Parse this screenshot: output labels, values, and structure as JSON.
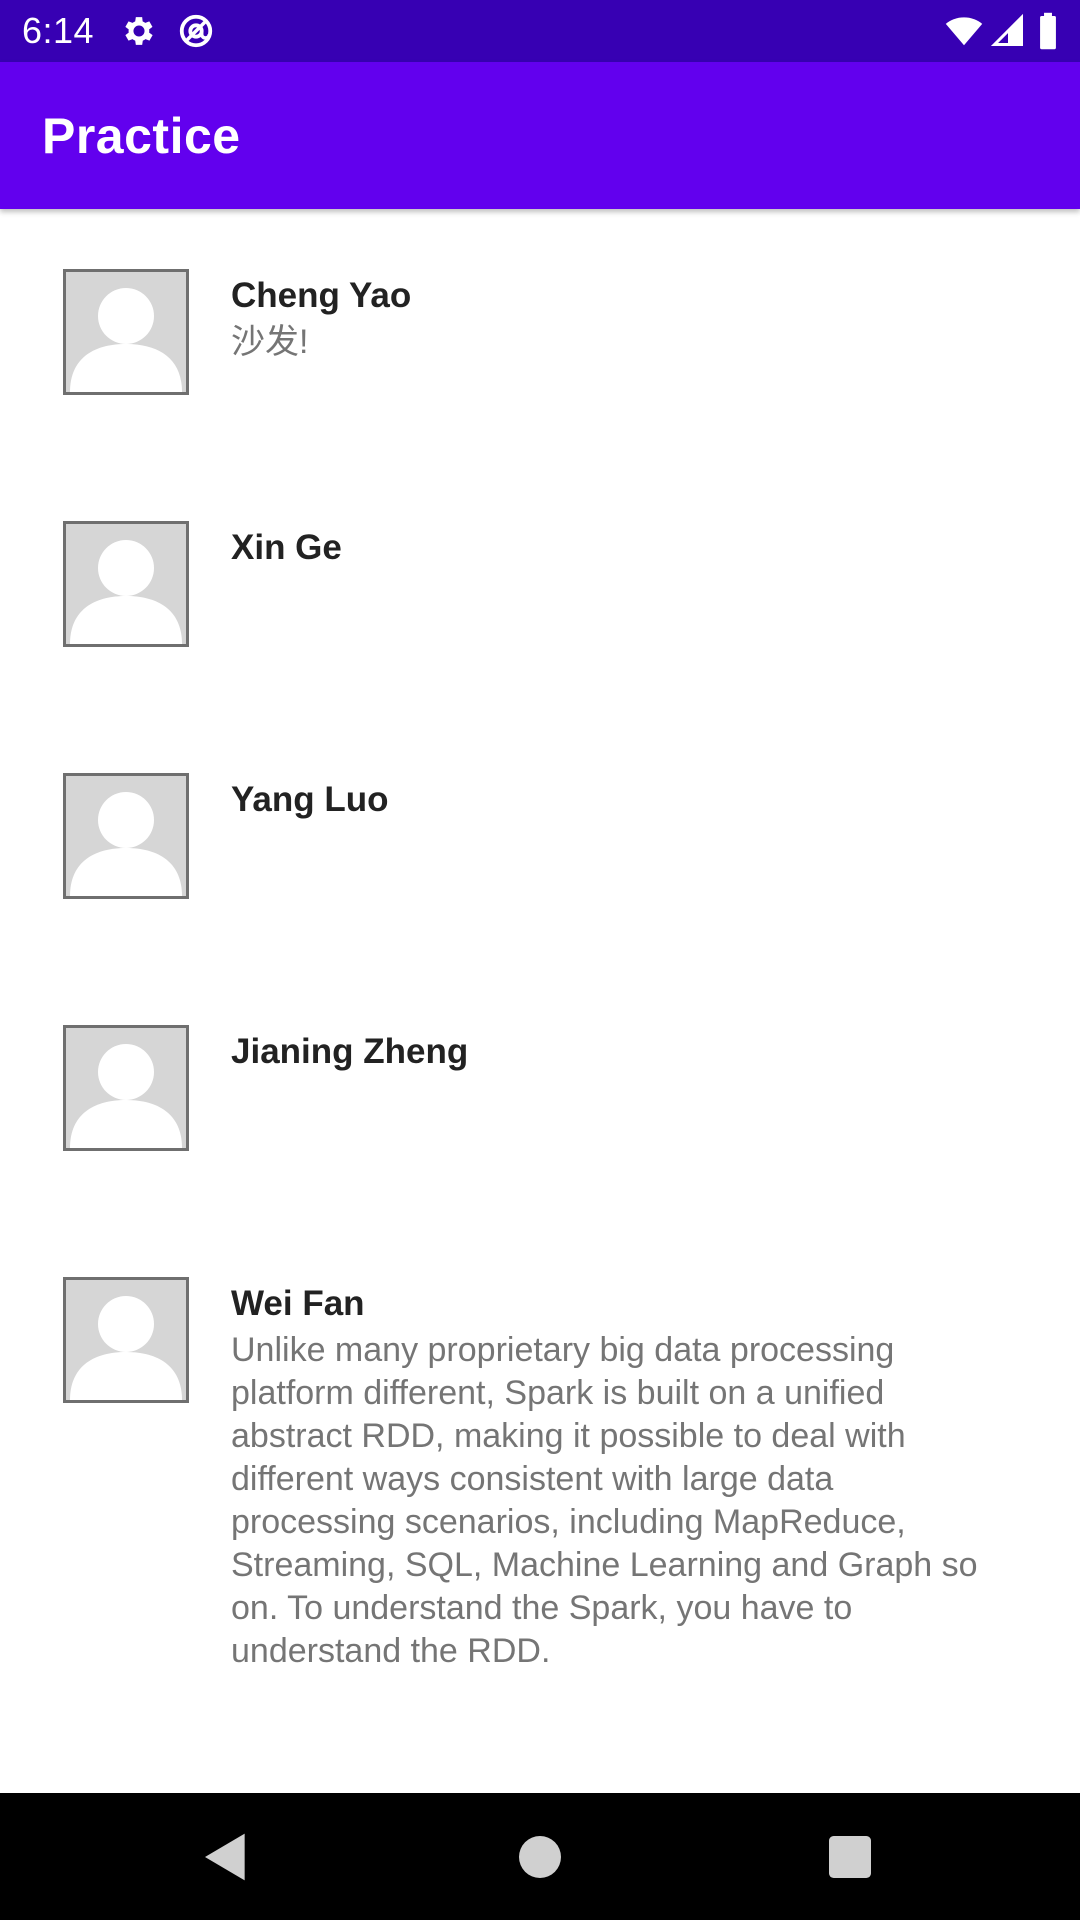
{
  "status_bar": {
    "time": "6:14",
    "icons": [
      "gear-icon",
      "at-sign-icon",
      "wifi-icon",
      "signal-icon",
      "battery-icon"
    ]
  },
  "app_bar": {
    "title": "Practice"
  },
  "contacts": [
    {
      "name": "Cheng Yao",
      "message": "沙发!"
    },
    {
      "name": "Xin Ge",
      "message": ""
    },
    {
      "name": "Yang Luo",
      "message": ""
    },
    {
      "name": "Jianing Zheng",
      "message": ""
    },
    {
      "name": "Wei Fan",
      "message": "Unlike many proprietary big data processing platform different, Spark is built on a unified abstract RDD, making it possible to deal with different ways consistent with large data processing scenarios, including MapReduce, Streaming, SQL, Machine Learning and Graph so on. To understand the Spark, you have to understand the RDD."
    }
  ],
  "nav_bar": {
    "icons": [
      "back-icon",
      "home-icon",
      "recents-icon"
    ]
  },
  "colors": {
    "status_bar": "#3700b3",
    "app_bar": "#6200ee",
    "background": "#ffffff",
    "name_text": "#222222",
    "message_text": "#757575",
    "nav_bar": "#000000"
  }
}
